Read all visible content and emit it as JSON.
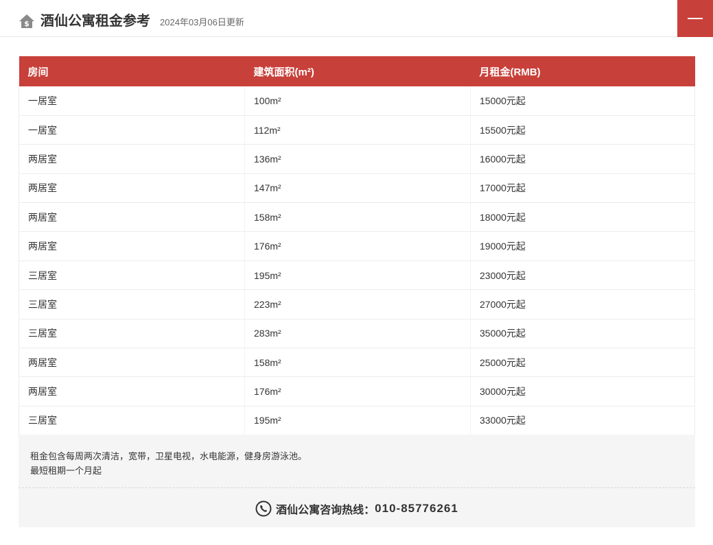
{
  "header": {
    "title": "酒仙公寓租金参考",
    "updated": "2024年03月06日更新"
  },
  "table": {
    "headers": [
      "房间",
      "建筑面积(m²)",
      "月租金(RMB)"
    ],
    "rows": [
      [
        "一居室",
        "100m²",
        "15000元起"
      ],
      [
        "一居室",
        "112m²",
        "15500元起"
      ],
      [
        "两居室",
        "136m²",
        "16000元起"
      ],
      [
        "两居室",
        "147m²",
        "17000元起"
      ],
      [
        "两居室",
        "158m²",
        "18000元起"
      ],
      [
        "两居室",
        "176m²",
        "19000元起"
      ],
      [
        "三居室",
        "195m²",
        "23000元起"
      ],
      [
        "三居室",
        "223m²",
        "27000元起"
      ],
      [
        "三居室",
        "283m²",
        "35000元起"
      ],
      [
        "两居室",
        "158m²",
        "25000元起"
      ],
      [
        "两居室",
        "176m²",
        "30000元起"
      ],
      [
        "三居室",
        "195m²",
        "33000元起"
      ]
    ]
  },
  "notes": {
    "line1": "租金包含每周两次清洁，宽带，卫星电视，水电能源，健身房游泳池。",
    "line2": "最短租期一个月起"
  },
  "hotline": {
    "label": "酒仙公寓咨询热线：",
    "number": "010-85776261"
  },
  "icons": {
    "header": "home-dollar-icon",
    "menu": "menu-icon",
    "hotline": "phone-icon"
  },
  "colors": {
    "accent": "#c8403a",
    "panel": "#f5f5f5"
  }
}
